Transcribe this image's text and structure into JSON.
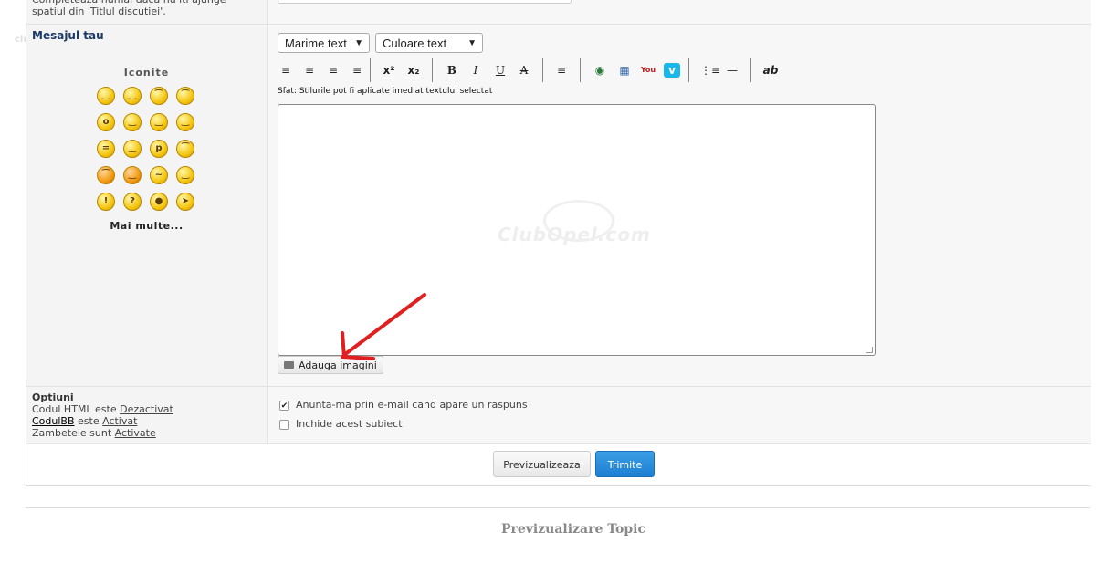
{
  "top_hint": "Completeaza numai daca nu iti ajunge spatiul din 'Titlul discutiei'.",
  "message": {
    "label": "Mesajul tau",
    "emoticons_title": "Iconite",
    "emoticons": [
      "grin",
      "big-smile",
      "sad",
      "worried",
      "eek",
      "smile",
      "cool",
      "wink",
      "squint",
      "tongue",
      "razz",
      "frown",
      "angry",
      "evil",
      "rolleyes",
      "happy",
      "exclamation",
      "question",
      "idea",
      "arrow"
    ],
    "more_label": "Mai multe..."
  },
  "toolbar": {
    "size_select": "Marime text",
    "color_select": "Culoare text",
    "tip": "Sfat: Stilurile pot fi aplicate imediat textului selectat"
  },
  "editor": {
    "watermark": "ClubOpel.com",
    "add_images_label": "Adauga imagini"
  },
  "options": {
    "title": "Optiuni",
    "html_line_prefix": "Codul HTML este",
    "html_status": "Dezactivat",
    "bb_label": "CodulBB",
    "bb_middle": "este",
    "bb_status": "Activat",
    "smilies_prefix": "Zambetele sunt",
    "smilies_status": "Activate",
    "notify_label": "Anunta-ma prin e-mail cand apare un raspuns",
    "notify_checked": true,
    "close_label": "Inchide acest subiect",
    "close_checked": false
  },
  "buttons": {
    "preview": "Previzualizeaza",
    "submit": "Trimite"
  },
  "footer": {
    "preview_heading": "Previzualizare Topic"
  },
  "colors": {
    "submit_bg": "#2a8bdc",
    "arrow": "#e02020",
    "label_blue": "#1b3a66"
  }
}
